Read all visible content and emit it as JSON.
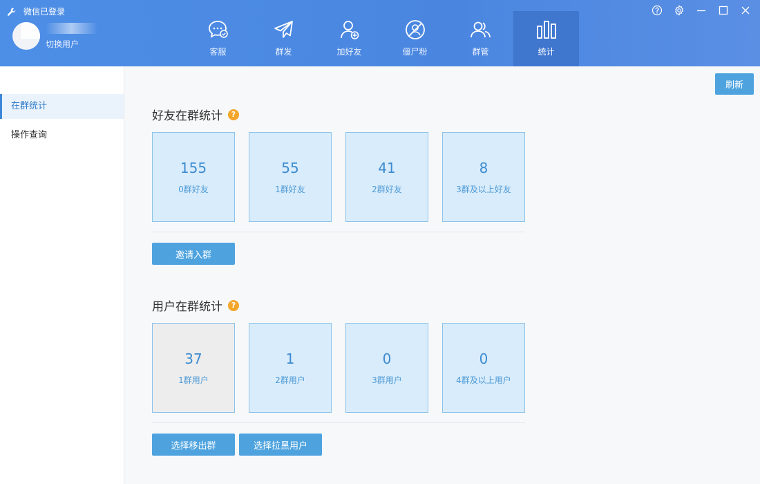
{
  "window": {
    "title": "微信已登录"
  },
  "user": {
    "name": "",
    "switch_label": "切换用户"
  },
  "nav": [
    {
      "label": "客服",
      "icon": "chat-bubble-icon"
    },
    {
      "label": "群发",
      "icon": "paper-plane-icon"
    },
    {
      "label": "加好友",
      "icon": "add-user-icon"
    },
    {
      "label": "僵尸粉",
      "icon": "zombie-user-icon"
    },
    {
      "label": "群管",
      "icon": "group-users-icon"
    },
    {
      "label": "统计",
      "icon": "bar-chart-icon",
      "active": true
    }
  ],
  "sidebar": {
    "items": [
      {
        "label": "在群统计",
        "active": true
      },
      {
        "label": "操作查询",
        "active": false
      }
    ]
  },
  "toolbar": {
    "refresh_label": "刷新"
  },
  "friends_section": {
    "title": "好友在群统计",
    "help": "?",
    "cards": [
      {
        "value": "155",
        "label": "0群好友"
      },
      {
        "value": "55",
        "label": "1群好友"
      },
      {
        "value": "41",
        "label": "2群好友"
      },
      {
        "value": "8",
        "label": "3群及以上好友"
      }
    ],
    "invite_label": "邀请入群"
  },
  "users_section": {
    "title": "用户在群统计",
    "help": "?",
    "cards": [
      {
        "value": "37",
        "label": "1群用户"
      },
      {
        "value": "1",
        "label": "2群用户"
      },
      {
        "value": "0",
        "label": "3群用户"
      },
      {
        "value": "0",
        "label": "4群及以上用户"
      }
    ],
    "remove_label": "选择移出群",
    "blacklist_label": "选择拉黑用户"
  },
  "colors": {
    "header": "#4a86e0",
    "accent_button": "#4ea3df",
    "card_bg": "#d9ecfb",
    "card_border": "#8cc3ea",
    "help_icon": "#f3a62a"
  }
}
